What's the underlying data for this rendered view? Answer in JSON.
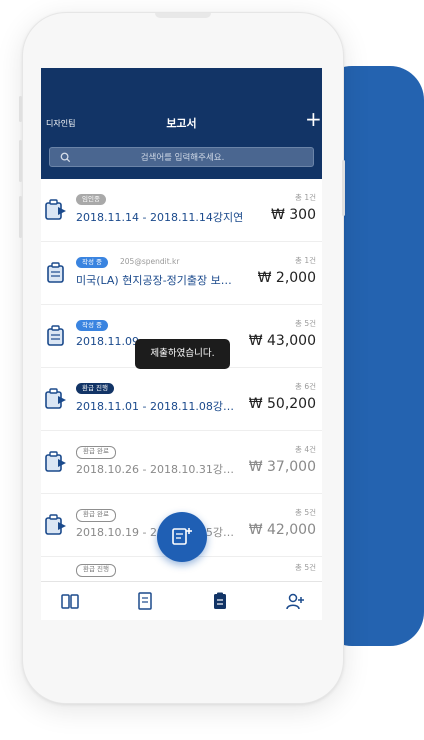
{
  "header": {
    "left_label": "디자인팀",
    "title": "보고서",
    "add_symbol": "+"
  },
  "search": {
    "placeholder": "검색어를 입력해주세요."
  },
  "reports": [
    {
      "badge": "임인종",
      "email": "",
      "title": "2018.11.14 - 2018.11.14강지연",
      "count": "총 1건",
      "amount": "₩ 300"
    },
    {
      "badge": "작성 중",
      "email": "205@spendit.kr",
      "title": "미국(LA) 현지공장-정기출장 보…",
      "count": "총 1건",
      "amount": "₩ 2,000"
    },
    {
      "badge": "작성 중",
      "email": "",
      "title": "2018.11.09",
      "count": "총 5건",
      "amount": "₩ 43,000"
    },
    {
      "badge": "환급 진행",
      "email": "",
      "title": "2018.11.01 - 2018.11.08강…",
      "count": "총 6건",
      "amount": "₩ 50,200"
    },
    {
      "badge": "환급 완료",
      "email": "",
      "title": "2018.10.26 - 2018.10.31강…",
      "count": "총 4건",
      "amount": "₩ 37,000"
    },
    {
      "badge": "환급 완료",
      "email": "",
      "title": "2018.10.19 - 2018.10.25강…",
      "count": "총 5건",
      "amount": "₩ 42,000"
    },
    {
      "badge": "환급 진행",
      "email": "",
      "title": "",
      "count": "총 5건",
      "amount": ""
    }
  ],
  "toast": "제출하였습니다.",
  "tabs": [
    "card-icon",
    "receipt-icon",
    "report-icon",
    "user-add-icon"
  ],
  "colors": {
    "brand_navy": "#123466",
    "accent_blue": "#1f5fb4",
    "backdrop_blue": "#2463b0",
    "badge_blue": "#3a84e0"
  }
}
